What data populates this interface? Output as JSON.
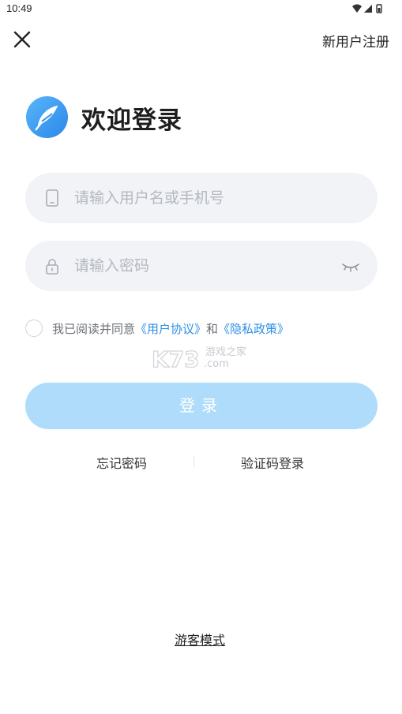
{
  "status_bar": {
    "time": "10:49"
  },
  "header": {
    "close_icon": "close-icon",
    "register_label": "新用户注册"
  },
  "brand": {
    "logo_icon": "feather-logo-icon",
    "welcome_title": "欢迎登录",
    "accent_color": "#3a9cf0"
  },
  "form": {
    "phone": {
      "placeholder": "请输入用户名或手机号",
      "value": "",
      "icon": "phone-icon"
    },
    "password": {
      "placeholder": "请输入密码",
      "value": "",
      "icon": "lock-icon",
      "toggle_icon": "eye-closed-icon"
    },
    "agreement": {
      "checked": false,
      "prefix": "我已阅读并同意",
      "user_agreement": "《用户协议》",
      "conjunction": "和",
      "privacy_policy": "《隐私政策》",
      "link_color": "#2c8fe6"
    },
    "login_label": "登录",
    "login_button_color": "#b0dcfb"
  },
  "links": {
    "forgot_password": "忘记密码",
    "sms_login": "验证码登录",
    "guest_mode": "游客模式"
  },
  "watermark": {
    "brand": "K73",
    "site_name": "游戏之家",
    "domain_suffix": ".com"
  }
}
